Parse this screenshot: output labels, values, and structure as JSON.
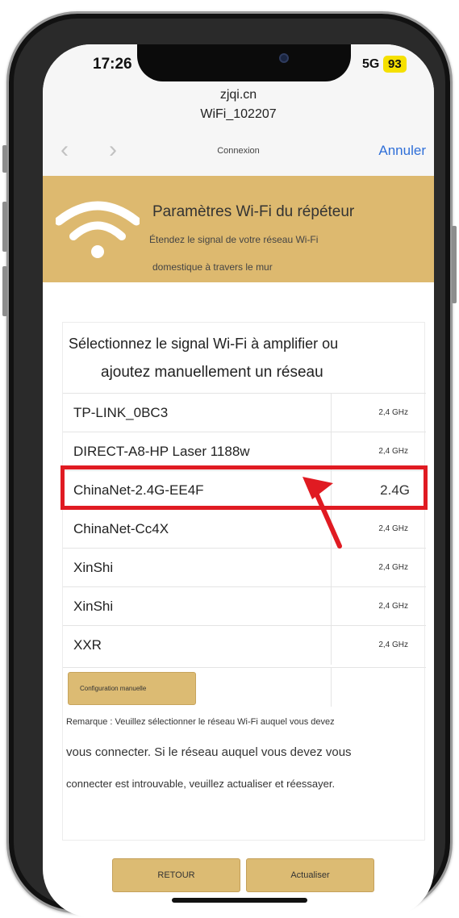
{
  "status": {
    "time": "17:26",
    "network": "5G",
    "battery": "93"
  },
  "header": {
    "url": "zjqi.cn",
    "ssid": "WiFi_102207",
    "title": "Connexion",
    "cancel": "Annuler",
    "back_icon": "chevron-left-icon",
    "forward_icon": "chevron-right-icon"
  },
  "banner": {
    "title": "Paramètres Wi-Fi du répéteur",
    "subtitle_line1": "Étendez le signal de votre réseau Wi-Fi",
    "subtitle_line2": "domestique à travers le mur",
    "icon": "wifi-icon"
  },
  "panel": {
    "heading_line1": "Sélectionnez le signal Wi-Fi à amplifier ou",
    "heading_line2": "ajoutez manuellement un réseau"
  },
  "networks": [
    {
      "name": "TP-LINK_0BC3",
      "band": "2,4 GHz"
    },
    {
      "name": "DIRECT-A8-HP Laser 1188w",
      "band": "2,4 GHz"
    },
    {
      "name": "ChinaNet-2.4G-EE4F",
      "band": "2.4G",
      "selected": true
    },
    {
      "name": "ChinaNet-Cc4X",
      "band": "2,4 GHz"
    },
    {
      "name": "XinShi",
      "band": "2,4 GHz"
    },
    {
      "name": "XinShi",
      "band": "2,4 GHz"
    },
    {
      "name": "XXR",
      "band": "2,4 GHz"
    }
  ],
  "manual_button": "Configuration manuelle",
  "note": {
    "line1": "Remarque : Veuillez sélectionner le réseau Wi-Fi auquel vous devez",
    "line2": "vous connecter. Si le réseau auquel vous devez vous",
    "line3": "connecter est introuvable, veuillez actualiser et réessayer."
  },
  "buttons": {
    "back": "RETOUR",
    "refresh": "Actualiser"
  },
  "colors": {
    "accent": "#ddb96f",
    "highlight": "#e01b22",
    "link": "#2f6fd8"
  }
}
